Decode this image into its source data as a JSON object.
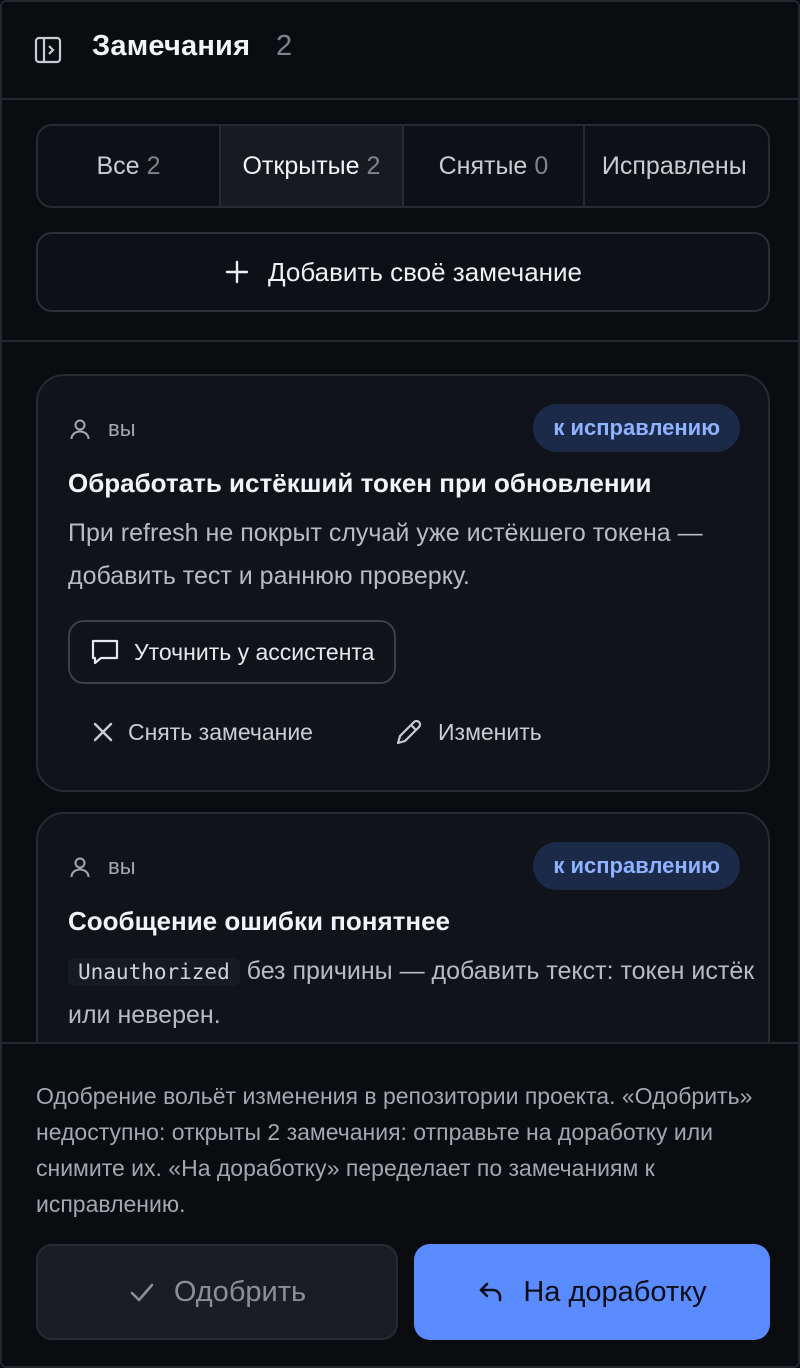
{
  "header": {
    "title": "Замечания",
    "count": "2",
    "toggle_icon": "panel-toggle-icon"
  },
  "tabs": [
    {
      "label": "Все",
      "count": "2",
      "active": false
    },
    {
      "label": "Открытые",
      "count": "2",
      "active": true
    },
    {
      "label": "Снятые",
      "count": "0",
      "active": false
    },
    {
      "label": "Исправлены",
      "count": "",
      "active": false
    }
  ],
  "add_button": {
    "label": "Добавить своё замечание",
    "icon": "plus-icon"
  },
  "comments": [
    {
      "author": "вы",
      "status": "к исправлению",
      "title": "Обработать истёкший токен при обновлении",
      "body": "При refresh не покрыт случай уже истёкшего токена — добавить тест и раннюю проверку.",
      "ask_label": "Уточнить у ассистента",
      "remove_label": "Снять замечание",
      "edit_label": "Изменить"
    },
    {
      "author": "вы",
      "status": "к исправлению",
      "title": "Сообщение ошибки понятнее",
      "body_code": "Unauthorized",
      "body_text": " без причины — добавить текст: токен истёк или неверен."
    }
  ],
  "footer": {
    "note": "Одобрение вольёт изменения в репозитории проекта. «Одобрить» недоступно: открыты 2 замечания: отправьте на доработку или снимите их. «На доработку» переделает по замечаниям к исправлению.",
    "approve_label": "Одобрить",
    "rework_label": "На доработку"
  },
  "colors": {
    "background": "#0b0c10",
    "accent": "#5b8cff",
    "badge_bg": "#1c2a4a",
    "badge_text": "#8eb2ff"
  }
}
